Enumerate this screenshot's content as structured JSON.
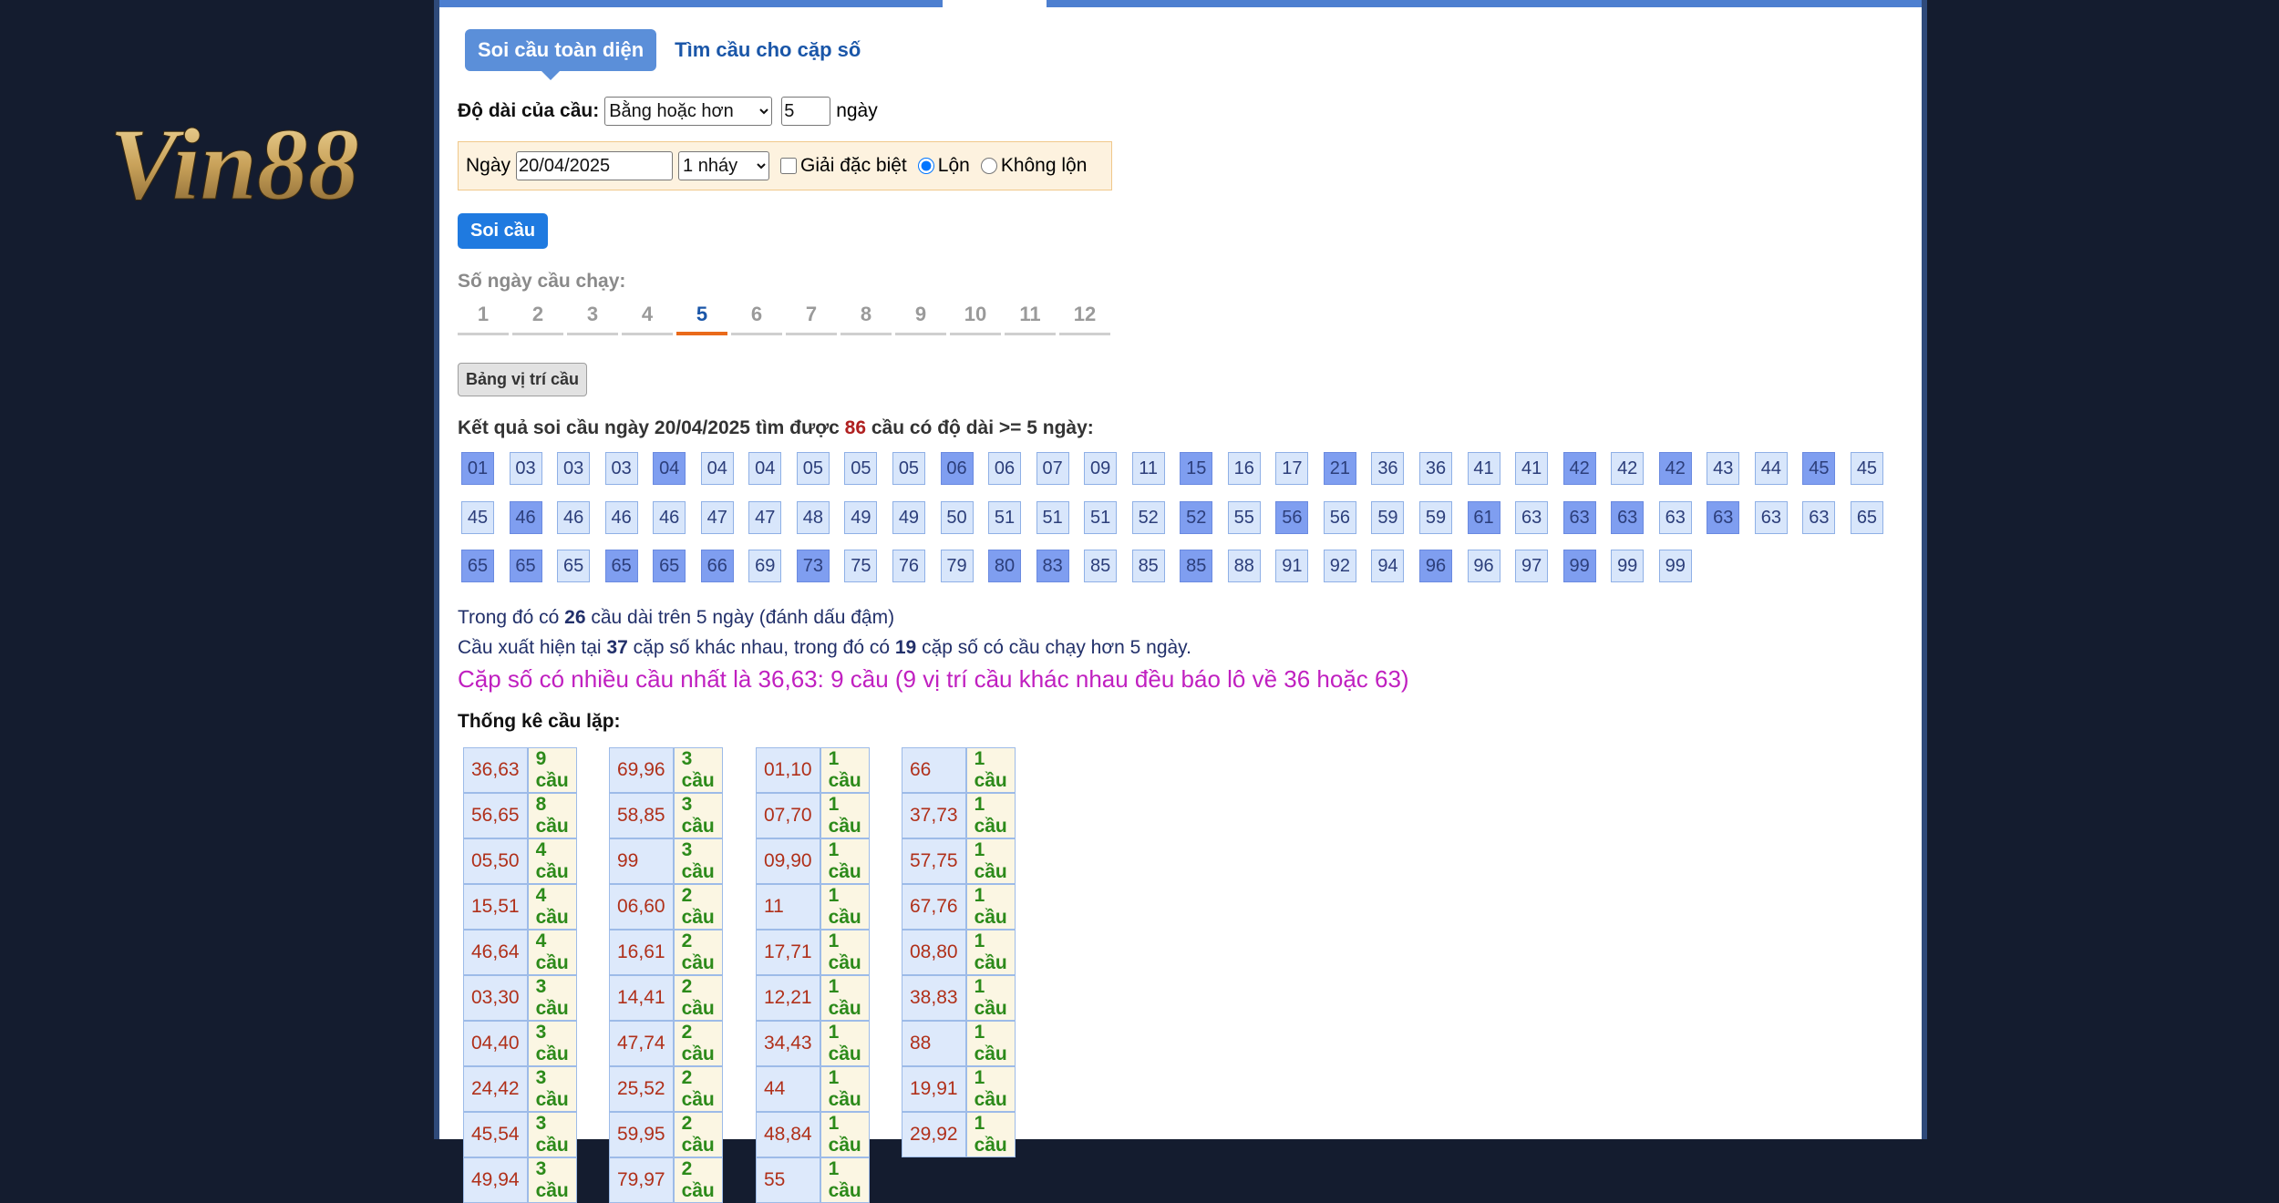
{
  "logo": {
    "text": "Vin88"
  },
  "tabs": [
    {
      "label": "Soi cầu toàn diện",
      "active": true
    },
    {
      "label": "Tìm cầu cho cặp số",
      "active": false
    }
  ],
  "form": {
    "length_label": "Độ dài của cầu:",
    "length_select": "Bằng hoặc hơn",
    "days_value": "5",
    "days_unit": "ngày",
    "date_label": "Ngày",
    "date_value": "20/04/2025",
    "nhay_select": "1 nháy",
    "special_label": "Giải đặc biệt",
    "lon_label": "Lộn",
    "khong_lon_label": "Không lộn",
    "submit_label": "Soi cầu"
  },
  "days": {
    "label": "Số ngày cầu chạy:",
    "items": [
      "1",
      "2",
      "3",
      "4",
      "5",
      "6",
      "7",
      "8",
      "9",
      "10",
      "11",
      "12"
    ],
    "active": "5"
  },
  "position_button": "Bảng vị trí cầu",
  "result": {
    "prefix": "Kết quả soi cầu ngày 20/04/2025 tìm được",
    "count": "86",
    "suffix": "cầu có độ dài >= 5 ngày:"
  },
  "numbers": [
    {
      "v": "01",
      "h": true
    },
    {
      "v": "03",
      "h": false
    },
    {
      "v": "03",
      "h": false
    },
    {
      "v": "03",
      "h": false
    },
    {
      "v": "04",
      "h": true
    },
    {
      "v": "04",
      "h": false
    },
    {
      "v": "04",
      "h": false
    },
    {
      "v": "05",
      "h": false
    },
    {
      "v": "05",
      "h": false
    },
    {
      "v": "05",
      "h": false
    },
    {
      "v": "06",
      "h": true
    },
    {
      "v": "06",
      "h": false
    },
    {
      "v": "07",
      "h": false
    },
    {
      "v": "09",
      "h": false
    },
    {
      "v": "11",
      "h": false
    },
    {
      "v": "15",
      "h": true
    },
    {
      "v": "16",
      "h": false
    },
    {
      "v": "17",
      "h": false
    },
    {
      "v": "21",
      "h": true
    },
    {
      "v": "36",
      "h": false
    },
    {
      "v": "36",
      "h": false
    },
    {
      "v": "41",
      "h": false
    },
    {
      "v": "41",
      "h": false
    },
    {
      "v": "42",
      "h": true
    },
    {
      "v": "42",
      "h": false
    },
    {
      "v": "42",
      "h": true
    },
    {
      "v": "43",
      "h": false
    },
    {
      "v": "44",
      "h": false
    },
    {
      "v": "45",
      "h": true
    },
    {
      "v": "45",
      "h": false
    },
    {
      "v": "45",
      "h": false
    },
    {
      "v": "46",
      "h": true
    },
    {
      "v": "46",
      "h": false
    },
    {
      "v": "46",
      "h": false
    },
    {
      "v": "46",
      "h": false
    },
    {
      "v": "47",
      "h": false
    },
    {
      "v": "47",
      "h": false
    },
    {
      "v": "48",
      "h": false
    },
    {
      "v": "49",
      "h": false
    },
    {
      "v": "49",
      "h": false
    },
    {
      "v": "50",
      "h": false
    },
    {
      "v": "51",
      "h": false
    },
    {
      "v": "51",
      "h": false
    },
    {
      "v": "51",
      "h": false
    },
    {
      "v": "52",
      "h": false
    },
    {
      "v": "52",
      "h": true
    },
    {
      "v": "55",
      "h": false
    },
    {
      "v": "56",
      "h": true
    },
    {
      "v": "56",
      "h": false
    },
    {
      "v": "59",
      "h": false
    },
    {
      "v": "59",
      "h": false
    },
    {
      "v": "61",
      "h": true
    },
    {
      "v": "63",
      "h": false
    },
    {
      "v": "63",
      "h": true
    },
    {
      "v": "63",
      "h": true
    },
    {
      "v": "63",
      "h": false
    },
    {
      "v": "63",
      "h": true
    },
    {
      "v": "63",
      "h": false
    },
    {
      "v": "63",
      "h": false
    },
    {
      "v": "65",
      "h": false
    },
    {
      "v": "65",
      "h": true
    },
    {
      "v": "65",
      "h": true
    },
    {
      "v": "65",
      "h": false
    },
    {
      "v": "65",
      "h": true
    },
    {
      "v": "65",
      "h": true
    },
    {
      "v": "66",
      "h": true
    },
    {
      "v": "69",
      "h": false
    },
    {
      "v": "73",
      "h": true
    },
    {
      "v": "75",
      "h": false
    },
    {
      "v": "76",
      "h": false
    },
    {
      "v": "79",
      "h": false
    },
    {
      "v": "80",
      "h": true
    },
    {
      "v": "83",
      "h": true
    },
    {
      "v": "85",
      "h": false
    },
    {
      "v": "85",
      "h": false
    },
    {
      "v": "85",
      "h": true
    },
    {
      "v": "88",
      "h": false
    },
    {
      "v": "91",
      "h": false
    },
    {
      "v": "92",
      "h": false
    },
    {
      "v": "94",
      "h": false
    },
    {
      "v": "96",
      "h": true
    },
    {
      "v": "96",
      "h": false
    },
    {
      "v": "97",
      "h": false
    },
    {
      "v": "99",
      "h": true
    },
    {
      "v": "99",
      "h": false
    },
    {
      "v": "99",
      "h": false
    }
  ],
  "info": {
    "line1_prefix": "Trong đó có",
    "line1_count": "26",
    "line1_suffix": "cầu dài trên 5 ngày (đánh dấu đậm)",
    "line2_prefix": "Cầu xuất hiện tại",
    "line2_count1": "37",
    "line2_mid": "cặp số khác nhau, trong đó có",
    "line2_count2": "19",
    "line2_suffix": "cặp số có cầu chạy hơn 5 ngày.",
    "line3": "Cặp số có nhiều cầu nhất là 36,63: 9 cầu (9 vị trí cầu khác nhau đều báo lô về 36 hoặc 63)"
  },
  "stats_title": "Thống kê cầu lặp:",
  "stats": [
    [
      [
        "36,63",
        "9 cầu"
      ],
      [
        "56,65",
        "8 cầu"
      ],
      [
        "05,50",
        "4 cầu"
      ],
      [
        "15,51",
        "4 cầu"
      ],
      [
        "46,64",
        "4 cầu"
      ],
      [
        "03,30",
        "3 cầu"
      ],
      [
        "04,40",
        "3 cầu"
      ],
      [
        "24,42",
        "3 cầu"
      ],
      [
        "45,54",
        "3 cầu"
      ],
      [
        "49,94",
        "3 cầu"
      ]
    ],
    [
      [
        "69,96",
        "3 cầu"
      ],
      [
        "58,85",
        "3 cầu"
      ],
      [
        "99",
        "3 cầu"
      ],
      [
        "06,60",
        "2 cầu"
      ],
      [
        "16,61",
        "2 cầu"
      ],
      [
        "14,41",
        "2 cầu"
      ],
      [
        "47,74",
        "2 cầu"
      ],
      [
        "25,52",
        "2 cầu"
      ],
      [
        "59,95",
        "2 cầu"
      ],
      [
        "79,97",
        "2 cầu"
      ]
    ],
    [
      [
        "01,10",
        "1 cầu"
      ],
      [
        "07,70",
        "1 cầu"
      ],
      [
        "09,90",
        "1 cầu"
      ],
      [
        "11",
        "1 cầu"
      ],
      [
        "17,71",
        "1 cầu"
      ],
      [
        "12,21",
        "1 cầu"
      ],
      [
        "34,43",
        "1 cầu"
      ],
      [
        "44",
        "1 cầu"
      ],
      [
        "48,84",
        "1 cầu"
      ],
      [
        "55",
        "1 cầu"
      ]
    ],
    [
      [
        "66",
        "1 cầu"
      ],
      [
        "37,73",
        "1 cầu"
      ],
      [
        "57,75",
        "1 cầu"
      ],
      [
        "67,76",
        "1 cầu"
      ],
      [
        "08,80",
        "1 cầu"
      ],
      [
        "38,83",
        "1 cầu"
      ],
      [
        "88",
        "1 cầu"
      ],
      [
        "19,91",
        "1 cầu"
      ],
      [
        "29,92",
        "1 cầu"
      ]
    ]
  ]
}
